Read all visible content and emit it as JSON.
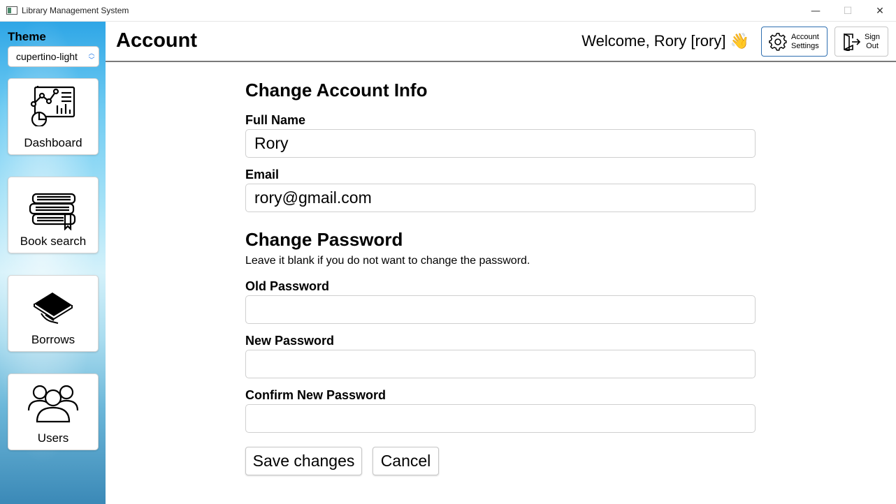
{
  "window": {
    "title": "Library Management System",
    "controls": {
      "minimize": "—",
      "maximize": "☐",
      "close": "✕"
    }
  },
  "sidebar": {
    "theme_label": "Theme",
    "theme_value": "cupertino-light",
    "items": [
      {
        "label": "Dashboard",
        "icon": "dashboard-icon"
      },
      {
        "label": "Book search",
        "icon": "books-icon"
      },
      {
        "label": "Borrows",
        "icon": "borrow-book-icon"
      },
      {
        "label": "Users",
        "icon": "users-icon"
      }
    ]
  },
  "header": {
    "title": "Account",
    "welcome": "Welcome, Rory [rory] 👋",
    "settings_label": "Account\nSettings",
    "signout_label": "Sign\nOut"
  },
  "form": {
    "account_heading": "Change Account Info",
    "full_name_label": "Full Name",
    "full_name_value": "Rory",
    "email_label": "Email",
    "email_value": "rory@gmail.com",
    "password_heading": "Change Password",
    "password_hint": "Leave it blank if you do not want to change the password.",
    "old_password_label": "Old Password",
    "new_password_label": "New Password",
    "confirm_password_label": "Confirm New Password",
    "old_password_value": "",
    "new_password_value": "",
    "confirm_password_value": "",
    "save_label": "Save changes",
    "cancel_label": "Cancel"
  },
  "colors": {
    "accent": "#2f6fb0",
    "select_arrows": "#1a73e8"
  }
}
